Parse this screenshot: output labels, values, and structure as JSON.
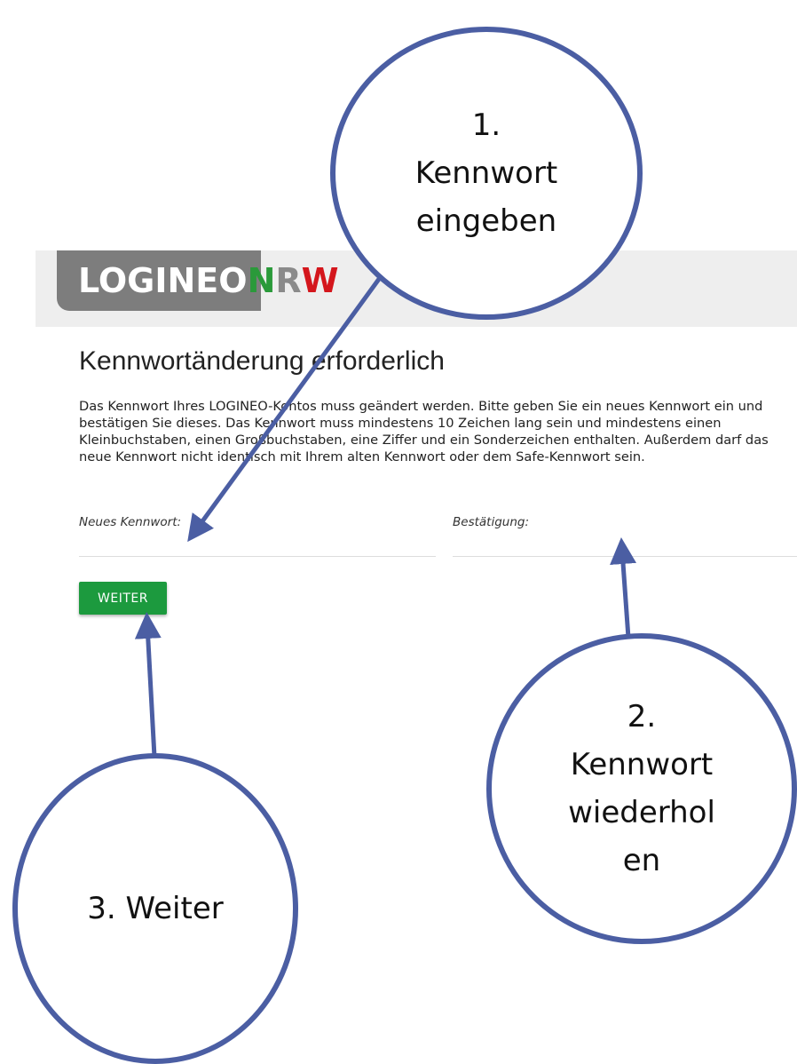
{
  "logo": {
    "main": "LOGINEO",
    "n": "N",
    "r": "R",
    "w": "W"
  },
  "page_title": "Kennwortänderung erforderlich",
  "description": "Das Kennwort Ihres LOGINEO-Kontos muss geändert werden. Bitte geben Sie ein neues Kennwort ein und bestätigen Sie dieses. Das Kennwort muss mindestens 10 Zeichen lang sein und mindestens einen Kleinbuchstaben, einen Großbuchstaben, eine Ziffer und ein Sonderzeichen enthalten. Außerdem darf das neue Kennwort nicht identisch mit Ihrem alten Kennwort oder dem Safe-Kennwort sein.",
  "form": {
    "new_password_label": "Neues Kennwort:",
    "confirm_label": "Bestätigung:",
    "new_password_value": "",
    "confirm_value": ""
  },
  "weiter_button": "WEITER",
  "annotations": {
    "step1": "1.\nKennwort\neingeben",
    "step2": "2.\nKennwort\nwiederhol\nen",
    "step3": "3. Weiter",
    "color": "#4b5ea3"
  },
  "colors": {
    "header_band": "#eeeeee",
    "logo_tab": "#7d7d7d",
    "logo_green": "#2a9a3a",
    "logo_red": "#d4161c",
    "button_green": "#1c9a3e"
  }
}
